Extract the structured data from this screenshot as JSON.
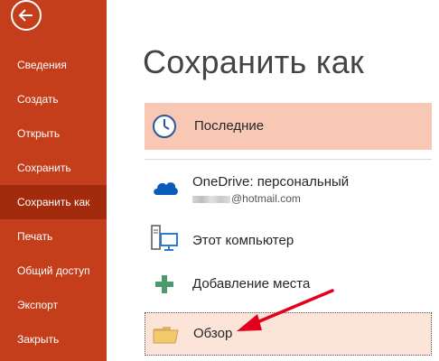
{
  "sidebar": {
    "items": [
      {
        "label": "Сведения"
      },
      {
        "label": "Создать"
      },
      {
        "label": "Открыть"
      },
      {
        "label": "Сохранить"
      },
      {
        "label": "Сохранить как"
      },
      {
        "label": "Печать"
      },
      {
        "label": "Общий доступ"
      },
      {
        "label": "Экспорт"
      },
      {
        "label": "Закрыть"
      }
    ],
    "active": "Сохранить как"
  },
  "main": {
    "title": "Сохранить как",
    "recent": {
      "label": "Последние"
    },
    "locations": [
      {
        "label": "OneDrive: персональный",
        "sublabel": "@hotmail.com"
      },
      {
        "label": "Этот компьютер"
      },
      {
        "label": "Добавление места"
      },
      {
        "label": "Обзор"
      }
    ]
  },
  "colors": {
    "sidebar_bg": "#c43e1c",
    "sidebar_active": "#a22a0d",
    "recent_highlight": "#f8c8b4",
    "browse_highlight": "#fce4d9",
    "annotation_arrow": "#e3001b"
  },
  "icons": {
    "back": "back-arrow-icon",
    "recent": "clock-icon",
    "onedrive": "cloud-icon",
    "computer": "computer-icon",
    "add_place": "plus-icon",
    "browse": "folder-icon"
  }
}
